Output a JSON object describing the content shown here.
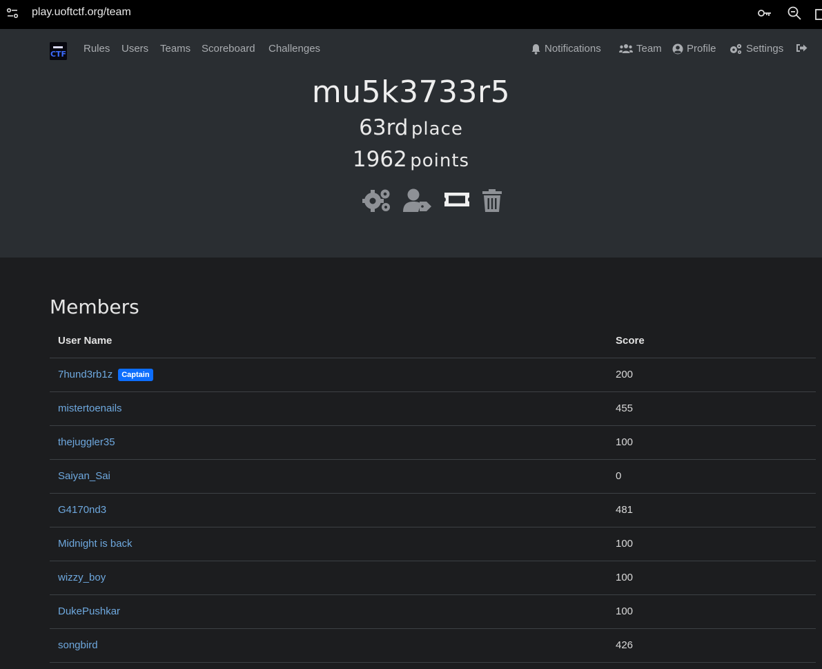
{
  "browser": {
    "url": "play.uoftctf.org/team"
  },
  "nav": {
    "logo_alt": "UofTCTF",
    "left_links": [
      "Rules",
      "Users",
      "Teams",
      "Scoreboard",
      "Challenges"
    ],
    "notifications": "Notifications",
    "team": "Team",
    "profile": "Profile",
    "settings": "Settings"
  },
  "team": {
    "name": "mu5k3733r5",
    "place_number": "63rd",
    "place_label": "place",
    "points_number": "1962",
    "points_label": "points"
  },
  "members": {
    "title": "Members",
    "columns": {
      "name": "User Name",
      "score": "Score"
    },
    "captain_badge": "Captain",
    "rows": [
      {
        "name": "7hund3rb1z",
        "score": "200",
        "captain": true
      },
      {
        "name": "mistertoenails",
        "score": "455"
      },
      {
        "name": "thejuggler35",
        "score": "100"
      },
      {
        "name": "Saiyan_Sai",
        "score": "0"
      },
      {
        "name": "G4170nd3",
        "score": "481"
      },
      {
        "name": "Midnight is back",
        "score": "100"
      },
      {
        "name": "wizzy_boy",
        "score": "100"
      },
      {
        "name": "DukePushkar",
        "score": "100"
      },
      {
        "name": "songbird",
        "score": "426"
      }
    ]
  },
  "colors": {
    "header_bg": "#2a2e32",
    "page_bg": "#1c1d1f",
    "link": "#6ea8de",
    "badge": "#0d6efd"
  }
}
